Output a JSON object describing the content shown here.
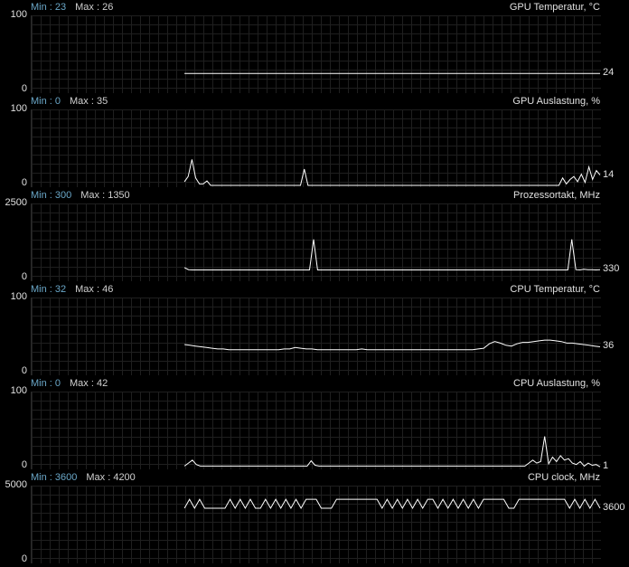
{
  "chart_data": [
    {
      "type": "line",
      "title": "GPU Temperatur, °C",
      "min_label": "Min : 23",
      "max_label": "Max : 26",
      "ylim": [
        0,
        100
      ],
      "ymax_label": "100",
      "ymin_label": "0",
      "current": "24",
      "start_fraction": 0.27,
      "values": [
        24,
        24,
        24,
        24,
        24,
        24,
        24,
        24,
        24,
        24,
        24,
        24,
        24,
        24,
        24,
        24,
        24,
        24,
        24,
        24,
        24,
        24,
        24,
        24,
        24,
        24,
        24,
        24,
        24,
        24,
        24,
        24,
        24,
        24,
        24,
        24,
        24,
        24,
        24,
        24,
        24,
        24,
        24,
        24,
        24,
        24,
        24,
        24,
        24,
        24,
        24,
        24,
        24,
        24,
        24,
        24,
        24,
        24,
        24,
        24
      ]
    },
    {
      "type": "line",
      "title": "GPU Auslastung, %",
      "min_label": "Min : 0",
      "max_label": "Max : 35",
      "ylim": [
        0,
        100
      ],
      "ymax_label": "100",
      "ymin_label": "0",
      "current": "14",
      "start_fraction": 0.27,
      "values": [
        5,
        12,
        35,
        10,
        2,
        2,
        6,
        0,
        0,
        0,
        0,
        0,
        0,
        0,
        0,
        0,
        0,
        0,
        0,
        0,
        0,
        0,
        0,
        0,
        0,
        0,
        0,
        0,
        0,
        0,
        0,
        0,
        22,
        0,
        0,
        0,
        0,
        0,
        0,
        0,
        0,
        0,
        0,
        0,
        0,
        0,
        0,
        0,
        0,
        0,
        0,
        0,
        0,
        0,
        0,
        0,
        0,
        0,
        0,
        0,
        0,
        0,
        0,
        0,
        0,
        0,
        0,
        0,
        0,
        0,
        0,
        0,
        0,
        0,
        0,
        0,
        0,
        0,
        0,
        0,
        0,
        0,
        0,
        0,
        0,
        0,
        0,
        0,
        0,
        0,
        0,
        0,
        0,
        0,
        0,
        0,
        0,
        0,
        0,
        0,
        0,
        10,
        2,
        8,
        12,
        5,
        15,
        4,
        25,
        8,
        20,
        14
      ]
    },
    {
      "type": "line",
      "title": "Prozessortakt, MHz",
      "min_label": "Min : 300",
      "max_label": "Max : 1350",
      "ylim": [
        0,
        2500
      ],
      "ymax_label": "2500",
      "ymin_label": "0",
      "current": "330",
      "start_fraction": 0.27,
      "values": [
        400,
        330,
        320,
        320,
        320,
        320,
        320,
        320,
        320,
        320,
        320,
        320,
        320,
        320,
        320,
        320,
        320,
        320,
        320,
        320,
        320,
        320,
        320,
        320,
        320,
        320,
        320,
        320,
        320,
        320,
        320,
        320,
        1350,
        320,
        320,
        320,
        320,
        320,
        320,
        320,
        320,
        320,
        320,
        320,
        320,
        320,
        320,
        320,
        320,
        320,
        320,
        320,
        320,
        320,
        320,
        320,
        320,
        320,
        320,
        320,
        320,
        320,
        320,
        320,
        320,
        320,
        320,
        320,
        320,
        320,
        320,
        320,
        320,
        320,
        320,
        320,
        320,
        320,
        320,
        320,
        320,
        320,
        320,
        320,
        320,
        320,
        320,
        320,
        320,
        320,
        320,
        320,
        320,
        320,
        320,
        320,
        1350,
        330,
        320,
        340,
        330,
        330,
        320,
        330
      ]
    },
    {
      "type": "line",
      "title": "CPU Temperatur, °C",
      "min_label": "Min : 32",
      "max_label": "Max : 46",
      "ylim": [
        0,
        100
      ],
      "ymax_label": "100",
      "ymin_label": "0",
      "current": "36",
      "start_fraction": 0.27,
      "values": [
        39,
        38,
        37,
        36,
        35,
        34,
        33,
        33,
        32,
        32,
        32,
        32,
        32,
        32,
        32,
        32,
        32,
        32,
        33,
        33,
        35,
        34,
        33,
        33,
        32,
        32,
        32,
        32,
        32,
        32,
        32,
        32,
        33,
        32,
        32,
        32,
        32,
        32,
        32,
        32,
        32,
        32,
        32,
        32,
        32,
        32,
        32,
        32,
        32,
        32,
        32,
        32,
        32,
        33,
        34,
        40,
        43,
        41,
        38,
        37,
        40,
        42,
        42,
        43,
        44,
        45,
        45,
        44,
        43,
        41,
        41,
        40,
        39,
        38,
        37,
        36
      ]
    },
    {
      "type": "line",
      "title": "CPU Auslastung, %",
      "min_label": "Min : 0",
      "max_label": "Max : 42",
      "ylim": [
        0,
        100
      ],
      "ymax_label": "100",
      "ymin_label": "0",
      "current": "1",
      "start_fraction": 0.27,
      "values": [
        2,
        6,
        10,
        4,
        2,
        2,
        2,
        2,
        2,
        2,
        2,
        2,
        2,
        2,
        2,
        2,
        2,
        2,
        2,
        2,
        2,
        2,
        2,
        2,
        2,
        2,
        2,
        2,
        2,
        2,
        2,
        2,
        9,
        3,
        2,
        2,
        2,
        2,
        2,
        2,
        2,
        2,
        2,
        2,
        2,
        2,
        2,
        2,
        2,
        2,
        2,
        2,
        2,
        2,
        2,
        2,
        2,
        2,
        2,
        2,
        2,
        2,
        2,
        2,
        2,
        2,
        2,
        2,
        2,
        2,
        2,
        2,
        2,
        2,
        2,
        2,
        2,
        2,
        2,
        2,
        2,
        2,
        2,
        2,
        2,
        2,
        2,
        6,
        10,
        6,
        8,
        42,
        5,
        14,
        8,
        16,
        10,
        12,
        6,
        4,
        8,
        2,
        6,
        3,
        4,
        1
      ]
    },
    {
      "type": "line",
      "title": "CPU clock, MHz",
      "min_label": "Min : 3600",
      "max_label": "Max : 4200",
      "ylim": [
        0,
        5000
      ],
      "ymax_label": "5000",
      "ymin_label": "0",
      "current": "3600",
      "start_fraction": 0.27,
      "values": [
        3600,
        4200,
        3600,
        4200,
        3600,
        3600,
        3600,
        3600,
        3600,
        4200,
        3600,
        4200,
        3600,
        4200,
        3600,
        3600,
        4200,
        3600,
        4200,
        3600,
        4200,
        3600,
        4200,
        3600,
        4200,
        4200,
        4200,
        3600,
        3600,
        3600,
        4200,
        4200,
        4200,
        4200,
        4200,
        4200,
        4200,
        4200,
        4200,
        3600,
        4200,
        3600,
        4200,
        3600,
        4200,
        3600,
        4200,
        3600,
        4200,
        4200,
        3600,
        4200,
        3600,
        4200,
        3600,
        4200,
        3600,
        4200,
        3600,
        4200,
        4200,
        4200,
        4200,
        4200,
        3600,
        3600,
        4200,
        4200,
        4200,
        4200,
        4200,
        4200,
        4200,
        4200,
        4200,
        4200,
        3600,
        4200,
        3600,
        4200,
        3600,
        4200,
        3600
      ]
    }
  ]
}
